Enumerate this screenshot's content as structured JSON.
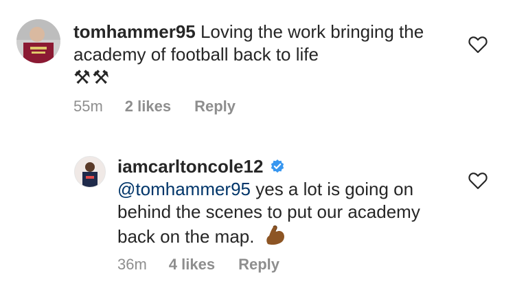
{
  "comments": [
    {
      "username": "tomhammer95",
      "text": "Loving the work bringing the academy of football back to life",
      "emoji": "⚒⚒",
      "time": "55m",
      "likes": "2 likes",
      "reply": "Reply"
    },
    {
      "username": "iamcarltoncole12",
      "verified": true,
      "mention": "@tomhammer95",
      "text": "yes a lot is going on behind the scenes to put our academy back on the map.",
      "emoji": "💪",
      "time": "36m",
      "likes": "4 likes",
      "reply": "Reply"
    }
  ],
  "colors": {
    "text": "#262626",
    "meta": "#8e8e8e",
    "mention": "#003569",
    "verified": "#3897f0"
  }
}
